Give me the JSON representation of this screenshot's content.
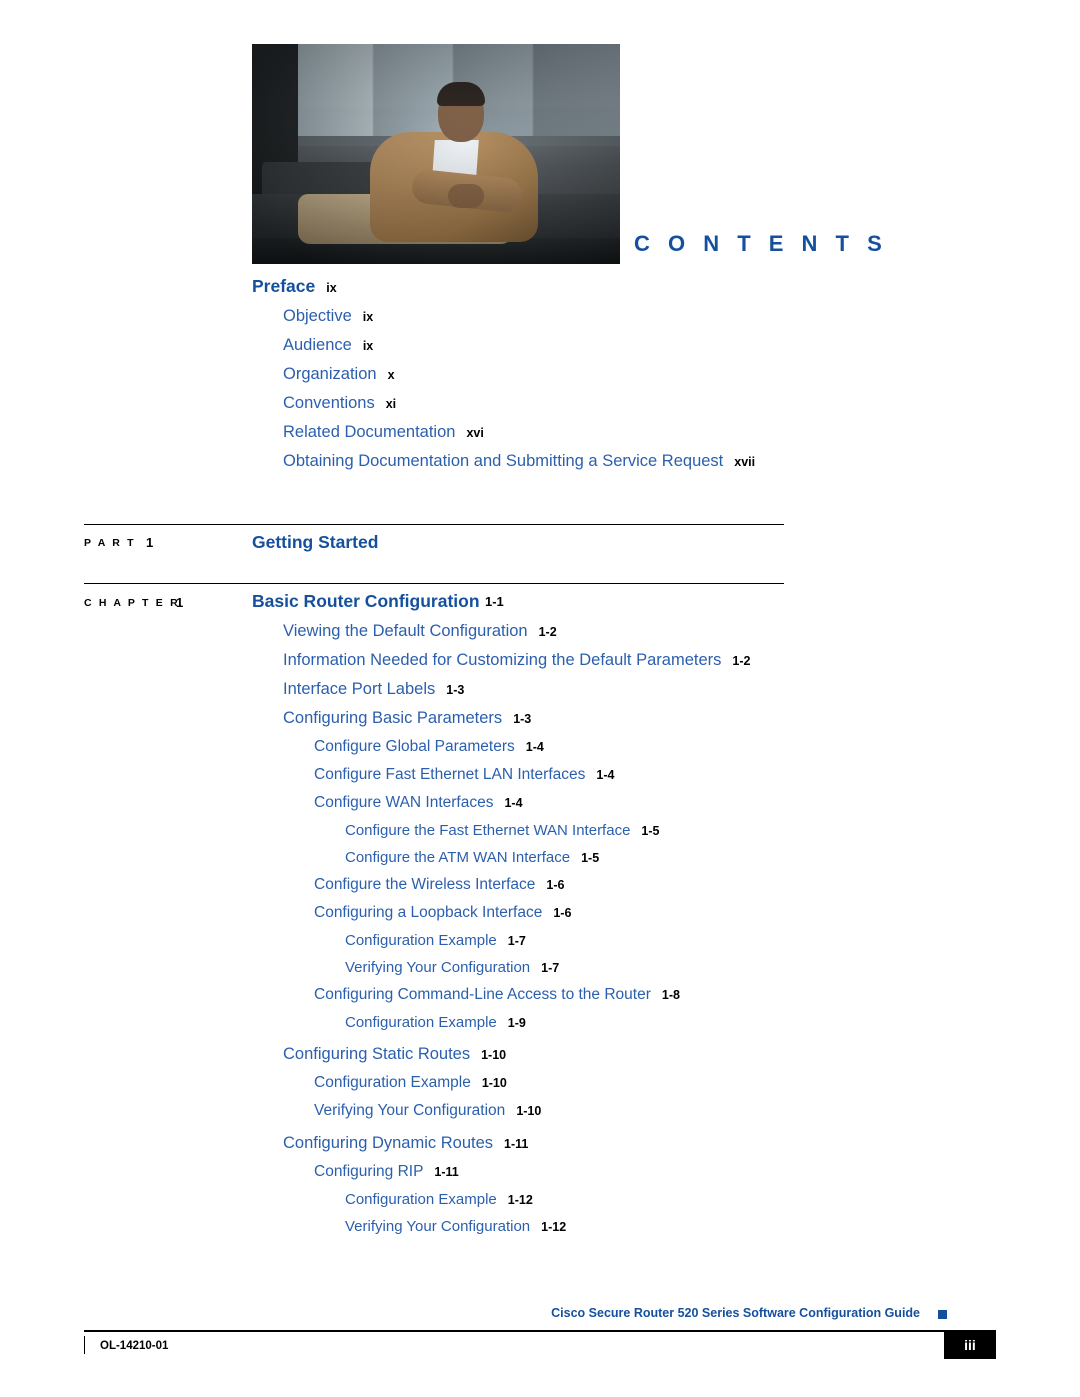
{
  "header": {
    "contents_title": "C O N T E N T S"
  },
  "toc": {
    "preface": {
      "label": "Preface",
      "page": "ix",
      "items": [
        {
          "label": "Objective",
          "page": "ix"
        },
        {
          "label": "Audience",
          "page": "ix"
        },
        {
          "label": "Organization",
          "page": "x"
        },
        {
          "label": "Conventions",
          "page": "xi"
        },
        {
          "label": "Related Documentation",
          "page": "xvi"
        },
        {
          "label": "Obtaining Documentation and Submitting a Service Request",
          "page": "xvii"
        }
      ]
    },
    "part": {
      "label": "P A R T",
      "number": "1",
      "title": "Getting Started"
    },
    "chapter": {
      "label": "C H A P T E R",
      "number": "1",
      "title": "Basic Router Configuration",
      "page": "1-1"
    },
    "entries": [
      {
        "label": "Viewing the Default Configuration",
        "page": "1-2",
        "level": 1
      },
      {
        "label": "Information Needed for Customizing the Default Parameters",
        "page": "1-2",
        "level": 1
      },
      {
        "label": "Interface Port Labels",
        "page": "1-3",
        "level": 1
      },
      {
        "label": "Configuring Basic Parameters",
        "page": "1-3",
        "level": 1
      },
      {
        "label": "Configure Global Parameters",
        "page": "1-4",
        "level": 2
      },
      {
        "label": "Configure Fast Ethernet LAN Interfaces",
        "page": "1-4",
        "level": 2
      },
      {
        "label": "Configure WAN Interfaces",
        "page": "1-4",
        "level": 2
      },
      {
        "label": "Configure the Fast Ethernet WAN Interface",
        "page": "1-5",
        "level": 3
      },
      {
        "label": "Configure the ATM WAN Interface",
        "page": "1-5",
        "level": 3
      },
      {
        "label": "Configure the Wireless Interface",
        "page": "1-6",
        "level": 2
      },
      {
        "label": "Configuring a Loopback Interface",
        "page": "1-6",
        "level": 2
      },
      {
        "label": "Configuration Example",
        "page": "1-7",
        "level": 3
      },
      {
        "label": "Verifying Your Configuration",
        "page": "1-7",
        "level": 3
      },
      {
        "label": "Configuring Command-Line Access to the Router",
        "page": "1-8",
        "level": 2
      },
      {
        "label": "Configuration Example",
        "page": "1-9",
        "level": 3
      },
      {
        "label": "Configuring Static Routes",
        "page": "1-10",
        "level": 1
      },
      {
        "label": "Configuration Example",
        "page": "1-10",
        "level": 2
      },
      {
        "label": "Verifying Your Configuration",
        "page": "1-10",
        "level": 2
      },
      {
        "label": "Configuring Dynamic Routes",
        "page": "1-11",
        "level": 1
      },
      {
        "label": "Configuring RIP",
        "page": "1-11",
        "level": 2
      },
      {
        "label": "Configuration Example",
        "page": "1-12",
        "level": 3
      },
      {
        "label": "Verifying Your Configuration",
        "page": "1-12",
        "level": 3
      }
    ]
  },
  "footer": {
    "guide_title": "Cisco Secure Router 520 Series Software Configuration Guide",
    "doc_id": "OL-14210-01",
    "page_number": "iii"
  }
}
